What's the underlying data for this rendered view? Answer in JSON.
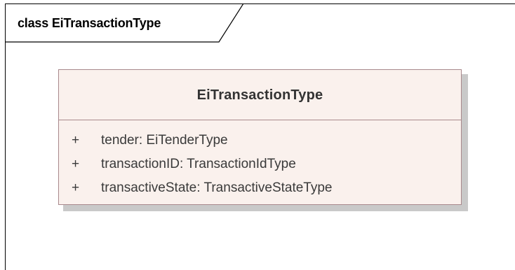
{
  "frame": {
    "title": "class EiTransactionType"
  },
  "class": {
    "name": "EiTransactionType",
    "attributes": [
      {
        "visibility": "+",
        "text": "tender: EiTenderType"
      },
      {
        "visibility": "+",
        "text": "transactionID: TransactionIdType"
      },
      {
        "visibility": "+",
        "text": "transactiveState: TransactiveStateType"
      }
    ]
  },
  "colors": {
    "class_fill": "#faf1ed",
    "class_border": "#a8888c",
    "shadow": "#c9c9c9"
  }
}
